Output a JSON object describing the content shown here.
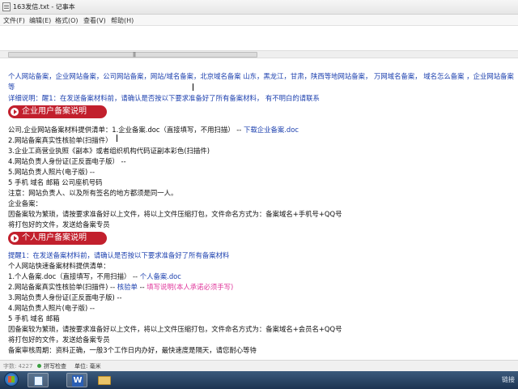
{
  "window": {
    "title": "163发信.txt - 记事本"
  },
  "menu": [
    "文件(F)",
    "编辑(E)",
    "格式(O)",
    "查看(V)",
    "帮助(H)"
  ],
  "scrollbar": {
    "grip": "|||"
  },
  "content": {
    "line1": "个人网站备案，企业网站备案，公司网站备案，网站/域名备案，北京域名备案 山东，黑龙江，甘肃，陕西等地网站备案， 万网域名备案， 域名怎么备案  ，企业网站备案",
    "line2": "等",
    "line3": "详细说明：醒1：在发送备案材料前，请确认是否按以下要求准备好了所有备案材料， 有不明白的请联系",
    "banner1": "企业用户备案说明",
    "c1_prefix": "公司,企业网站备案材料提供清单：1.企业备案.doc（直接填写，不用扫描） -- ",
    "c1_link": "下载企业备案.doc",
    "c2": "2.网站备案真实性核验单(扫描件）",
    "c3": "3.企业工商营业执照《副本》或者组织机构代码证副本彩色(扫描件)",
    "c4": "4.网站负责人身份证(正反面电子版） --",
    "c5": "5.网站负责人照片(电子版) --",
    "c6": "5 手机   域名  邮箱     公司座机号码",
    "c7": "注意：网站负责人、以及所有签名的地方都须是同一人。",
    "c8": "企业备案：",
    "c9": "因备案较为繁琐，请按要求准备好以上文件，将以上文件压缩打包，文件命名方式为：备案域名+手机号+QQ号",
    "c10": "将打包好的文件，发送给备案专员",
    "banner2": "个人用户备案说明",
    "p0": "提醒1：在发送备案材料前，请确认是否按以下要求准备好了所有备案材料",
    "p1": "个人网站快速备案材料提供清单：",
    "p2_prefix": "1.个人备案.doc（直接填写，不用扫描） -- ",
    "p2_link": "个人备案.doc",
    "p3_prefix": "2.网站备案真实性核验单(扫描件) -- ",
    "p3_link": "核验单",
    "p3_mid": " -- ",
    "p3_note": "填写说明(本人承诺必须手写)",
    "p4": "3.网站负责人身份证(正反面电子版) --",
    "p5": "4.网站负责人照片(电子版) --",
    "p6": "5 手机   域名  邮箱",
    "p7": "因备案较为繁琐，请按要求准备好以上文件，将以上文件压缩打包，文件命名方式为：备案域名+会员名+QQ号",
    "p8": "将打包好的文件，发送给备案专员",
    "p9": "备案审核周期：资料正确，一般3个工作日内办好，最快速度是隔天，请您耐心等待"
  },
  "statusbar": {
    "chars": "字数: 4227",
    "spell": "拼写检查",
    "unit": "单位: 毫米"
  },
  "taskbar": {
    "word_label": "W",
    "tray": "链接"
  }
}
